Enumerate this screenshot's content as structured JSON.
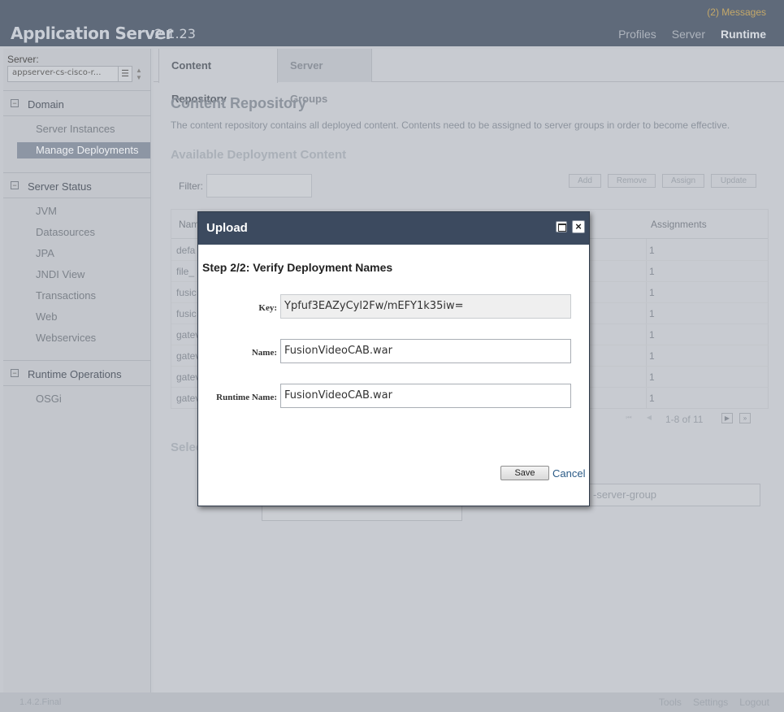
{
  "header": {
    "brand": "Application Server",
    "version": "2.1.23",
    "messages": "(2) Messages",
    "nav": [
      "Profiles",
      "Server",
      "Runtime"
    ]
  },
  "sidebar": {
    "server_label": "Server:",
    "server_value": "appserver-cs-cisco-r...",
    "groups": [
      {
        "title": "Domain",
        "items": [
          "Server Instances",
          "Manage Deployments"
        ]
      },
      {
        "title": "Server Status",
        "items": [
          "JVM",
          "Datasources",
          "JPA",
          "JNDI View",
          "Transactions",
          "Web",
          "Webservices"
        ]
      },
      {
        "title": "Runtime Operations",
        "items": [
          "OSGi"
        ]
      }
    ]
  },
  "main": {
    "tabs": [
      "Content Repository",
      "Server Groups"
    ],
    "title": "Content Repository",
    "description": "The content repository contains all deployed content. Contents need to be assigned to server groups in order to become effective.",
    "section_title": "Available Deployment Content",
    "filter_label": "Filter:",
    "toolbar": [
      "Add",
      "Remove",
      "Assign",
      "Update"
    ],
    "table": {
      "col_name": "Nam",
      "col_assignments": "Assignments",
      "rows": [
        {
          "name": "defa",
          "assignments": "1"
        },
        {
          "name": "file_",
          "assignments": "1"
        },
        {
          "name": "fusic",
          "assignments": "1"
        },
        {
          "name": "fusic",
          "assignments": "1"
        },
        {
          "name": "gatev",
          "assignments": "1"
        },
        {
          "name": "gatev",
          "assignments": "1"
        },
        {
          "name": "gatev",
          "assignments": "1"
        },
        {
          "name": "gatev",
          "assignments": "1"
        }
      ]
    },
    "pager_text": "1-8 of 11",
    "select_title": "Selec",
    "group_text": "-server-group"
  },
  "footer": {
    "version": "1.4.2.Final",
    "links": [
      "Tools",
      "Settings",
      "Logout"
    ]
  },
  "modal": {
    "title": "Upload",
    "step": "Step 2/2: Verify Deployment Names",
    "key_label": "Key:",
    "key_value": "Ypfuf3EAZyCyl2Fw/mEFY1k35iw=",
    "name_label": "Name:",
    "name_value": "FusionVideoCAB.war",
    "runtime_label": "Runtime Name:",
    "runtime_value": "FusionVideoCAB.war",
    "save": "Save",
    "cancel": "Cancel"
  }
}
